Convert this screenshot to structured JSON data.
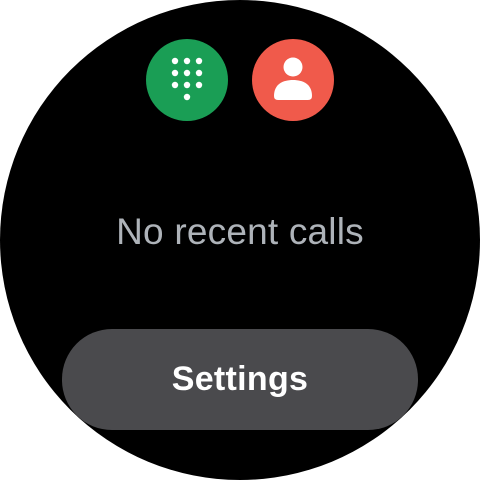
{
  "colors": {
    "background": "#000000",
    "dialpad_button": "#1a9e55",
    "contacts_button": "#f05a4b",
    "settings_button": "#4a4a4d",
    "empty_text": "#aeb3b9"
  },
  "actions": {
    "dialpad_icon": "dialpad-icon",
    "contacts_icon": "contact-person-icon"
  },
  "call_log": {
    "empty_message": "No recent calls"
  },
  "settings": {
    "label": "Settings"
  }
}
